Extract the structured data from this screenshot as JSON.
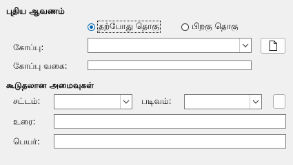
{
  "new_document": {
    "heading": "புதிய ஆவணம்",
    "radio_now": {
      "label": "தற்போது தொகு",
      "selected": true
    },
    "radio_later": {
      "label": "பிறகு தொகு",
      "selected": false
    },
    "file_label": "கோப்பு:",
    "file_value": "",
    "file_button_icon": "document-icon",
    "file_type_label": "கோப்பு வகை:",
    "file_type_value": ""
  },
  "additional_settings": {
    "heading": "கூடுதலான அமைவுகள்",
    "frame_label": "சட்டம்:",
    "frame_value": "",
    "form_label": "படிவம்:",
    "form_value": "",
    "text_label": "உரை:",
    "text_value": "",
    "name_label": "பெயர்:",
    "name_value": ""
  },
  "colors": {
    "accent": "#0063b1",
    "background": "#f0f0f0"
  }
}
